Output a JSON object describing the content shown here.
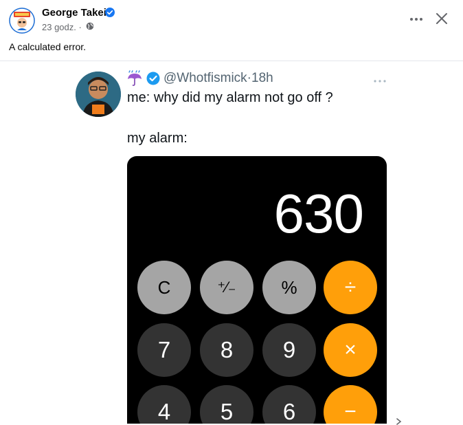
{
  "post": {
    "author": "George Takei",
    "time": "23 godz. ·",
    "caption": "A calculated error."
  },
  "icons": {
    "verified": "verified-badge-icon",
    "globe": "globe-icon",
    "more": "more-options-icon",
    "close": "close-icon"
  },
  "tweet": {
    "handle": "@Whotfismick·18h",
    "line1": "me: why did my alarm not go off ?",
    "line2": "my alarm:"
  },
  "calculator": {
    "display": "630",
    "keys": [
      "C",
      "⁺⁄₋",
      "%",
      "÷",
      "7",
      "8",
      "9",
      "×",
      "4",
      "5",
      "6",
      "−"
    ]
  },
  "colors": {
    "facebook_blue": "#1877f2",
    "twitter_blue": "#1d9bf0",
    "calc_orange": "#ff9f0a",
    "calc_light_gray": "#a5a5a5",
    "calc_dark_gray": "#333333"
  }
}
